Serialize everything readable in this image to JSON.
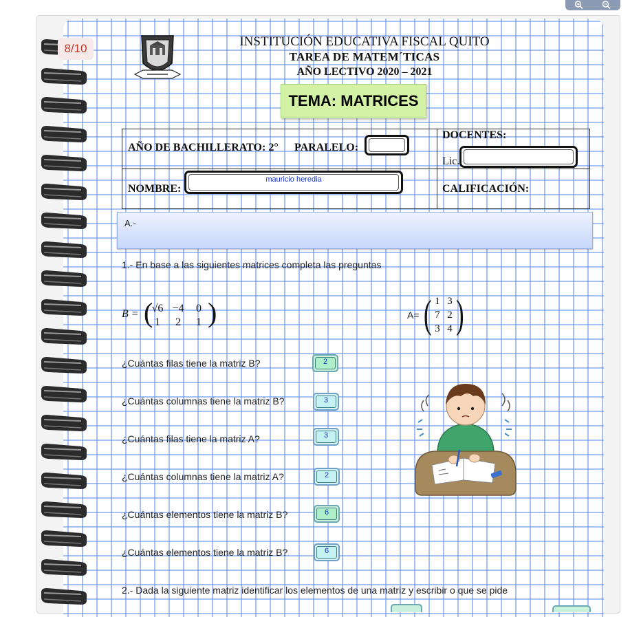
{
  "zoom": {
    "zoom_in_icon": "zoom-in-icon",
    "zoom_out_icon": "zoom-out-icon"
  },
  "page_indicator": "8/10",
  "header": {
    "school": "INSTITUCIÓN EDUCATIVA FISCAL QUITO",
    "task": "TAREA DE MATEM´TICAS",
    "year": "AÑO LECTIVO 2020 – 2021",
    "topic": "TEMA: MATRICES"
  },
  "form": {
    "grade_label": "AÑO DE BACHILLERATO: 2°",
    "parallel_label": "PARALELO:",
    "parallel_value": "",
    "teachers_label": "DOCENTES:",
    "lic_label": "Lic.",
    "lic_value": "",
    "name_label": "NOMBRE:",
    "name_value": "mauricio heredia",
    "grade_score_label": "CALIFICACIÓN:"
  },
  "section_a": {
    "label": "A.-"
  },
  "question1": {
    "prompt": "1.- En base a las siguientes matrices completa las preguntas",
    "matrix_b_label": "B =",
    "matrix_b_rows": [
      [
        "√6",
        "−4",
        "0"
      ],
      [
        "1",
        "2",
        "1"
      ]
    ],
    "matrix_a_label": "A=",
    "matrix_a_rows": [
      [
        "1",
        "3"
      ],
      [
        "7",
        "2"
      ],
      [
        "3",
        "4"
      ]
    ]
  },
  "questions": [
    {
      "text": "¿Cuántas filas tiene la matriz B?",
      "answer": "2"
    },
    {
      "text": "¿Cuántas columnas tiene la matriz B?",
      "answer": "3"
    },
    {
      "text": "¿Cuántas filas tiene la matriz A?",
      "answer": "3"
    },
    {
      "text": "¿Cuántas columnas tiene la matriz A?",
      "answer": "2"
    },
    {
      "text": "¿Cuántas elementos tiene la matriz B?",
      "answer": "6"
    },
    {
      "text": "¿Cuántas elementos tiene la matriz B?",
      "answer": "6"
    }
  ],
  "question2": {
    "prompt": "2.- Dada la siguiente matriz identificar los elementos de una matriz y escribir o que se pide"
  },
  "colors": {
    "grid": "#5a8ceb",
    "answer_fill": "#c9f0db",
    "answer_text": "#1a33c9",
    "topic_fill": "#d3f2a5",
    "page_indicator": "#c0392b"
  }
}
